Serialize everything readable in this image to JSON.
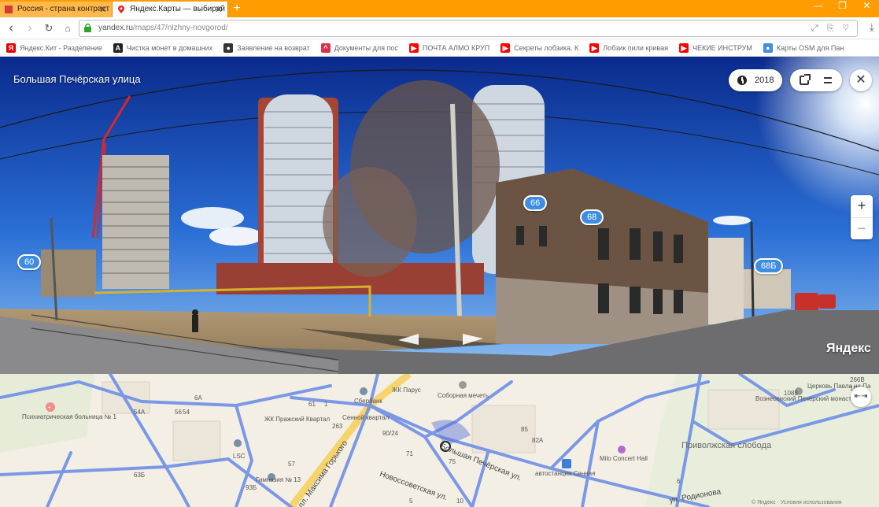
{
  "browser": {
    "tabs": [
      {
        "title": "Россия - страна контраст",
        "active": false
      },
      {
        "title": "Яндекс.Карты — выбирай",
        "active": true
      }
    ],
    "new_tab": "+",
    "window_controls": [
      "—",
      "❐",
      "✕"
    ],
    "url_host": "yandex.ru",
    "url_path": "/maps/47/nizhny-novgorod/",
    "accent": "#ff9d00"
  },
  "bookmarks": [
    {
      "label": "Яндекс.Кит - Разделение",
      "icon": "yandex-icon",
      "color": "#e30000"
    },
    {
      "label": "Чистка монет в домашних",
      "icon": "letter-a-icon",
      "color": "#222222"
    },
    {
      "label": "Заявление на возврат",
      "icon": "dot-icon",
      "color": "#333333"
    },
    {
      "label": "Документы для пос",
      "icon": "chevron-up-icon",
      "color": "#d6334a"
    },
    {
      "label": "ПОЧТА АЛМО КРУП",
      "icon": "youtube-icon",
      "color": "#ff0000"
    },
    {
      "label": "Секреты лобзика. К",
      "icon": "youtube-icon",
      "color": "#ff0000"
    },
    {
      "label": "Лобзик пили кривая",
      "icon": "youtube-icon",
      "color": "#ff0000"
    },
    {
      "label": "ЧЕКИЕ ИНСТРУМ",
      "icon": "youtube-icon",
      "color": "#ff0000"
    },
    {
      "label": "Карты OSM для Пан",
      "icon": "map-pin-icon",
      "color": "#3d8de0"
    }
  ],
  "panorama": {
    "street_title": "Большая Печёрская улица",
    "year": "2018",
    "zoom_in": "+",
    "zoom_out": "−",
    "close": "✕",
    "watermark": "Яндекс",
    "house_numbers": [
      "60",
      "66",
      "68",
      "68Б"
    ]
  },
  "map": {
    "labels": {
      "hospital": "Психиатрическая больница № 1",
      "zhk_prazhsky": "ЖК Пражский Квартал",
      "senny": "Сенной квартал",
      "zhk_parus": "ЖК Парус",
      "sobornaya": "Соборная мечеть",
      "sberbank": "Сбербанк",
      "gymnasium": "Гимназия № 13",
      "lsc": "LSC",
      "milo": "Milo Concert Hall",
      "bus": "автостанция Сенная",
      "prim": "Приволжская слобода",
      "church": "Церковь Павла на Па",
      "monastery": "Вознесенский Печерский монастырь",
      "street_main": "Большая Печёрская ул.",
      "street_gorky": "пл. Максима Горького",
      "street_rod": "ул. Родионова",
      "street_novo": "Новоссоветская ул.",
      "attrib": "© Яндекс · Условия использования"
    },
    "numbers": [
      "54A",
      "56",
      "54",
      "6A",
      "61",
      "1",
      "263",
      "57",
      "63Б",
      "93Б",
      "90/24",
      "71",
      "75",
      "85",
      "82A",
      "266В",
      "1086",
      "1088",
      "6",
      "5",
      "10"
    ]
  }
}
